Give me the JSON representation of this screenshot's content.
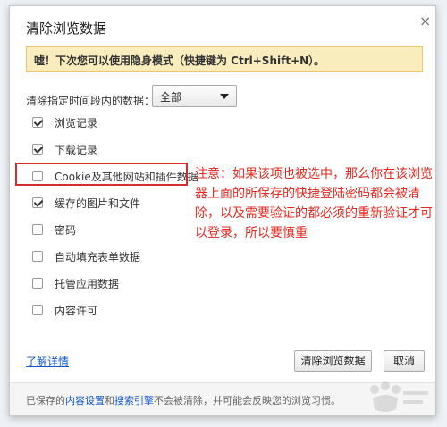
{
  "dialog": {
    "title": "清除浏览数据",
    "close_glyph": "×",
    "banner_text": "嘘！下次您可以使用隐身模式（快捷键为 Ctrl+Shift+N）。",
    "range_label": "清除指定时间段内的数据：",
    "range_value": "全部",
    "options": [
      {
        "label": "浏览记录",
        "checked": true
      },
      {
        "label": "下载记录",
        "checked": true
      },
      {
        "label": "Cookie及其他网站和插件数据",
        "checked": false
      },
      {
        "label": "缓存的图片和文件",
        "checked": true
      },
      {
        "label": "密码",
        "checked": false
      },
      {
        "label": "自动填充表单数据",
        "checked": false
      },
      {
        "label": "托管应用数据",
        "checked": false
      },
      {
        "label": "内容许可",
        "checked": false
      }
    ],
    "learn_more": "了解详情",
    "clear_button": "清除浏览数据",
    "cancel_button": "取消",
    "footer": {
      "prefix": "已保存的",
      "link1": "内容设置",
      "middle": "和",
      "link2": "搜索引擎",
      "suffix": "不会被清除，并可能会反映您的浏览习惯。"
    }
  },
  "annotation": {
    "note": "注意：如果该项也被选中，那么你在该浏览器上面的所保存的快捷登陆密码都会被清除，以及需要验证的都必须的重新验证才可以登录，所以要慎重",
    "color": "#e8261d"
  },
  "colors": {
    "banner_bg": "#f9edbe",
    "link": "#1155cc",
    "highlight": "#d42e2e"
  }
}
